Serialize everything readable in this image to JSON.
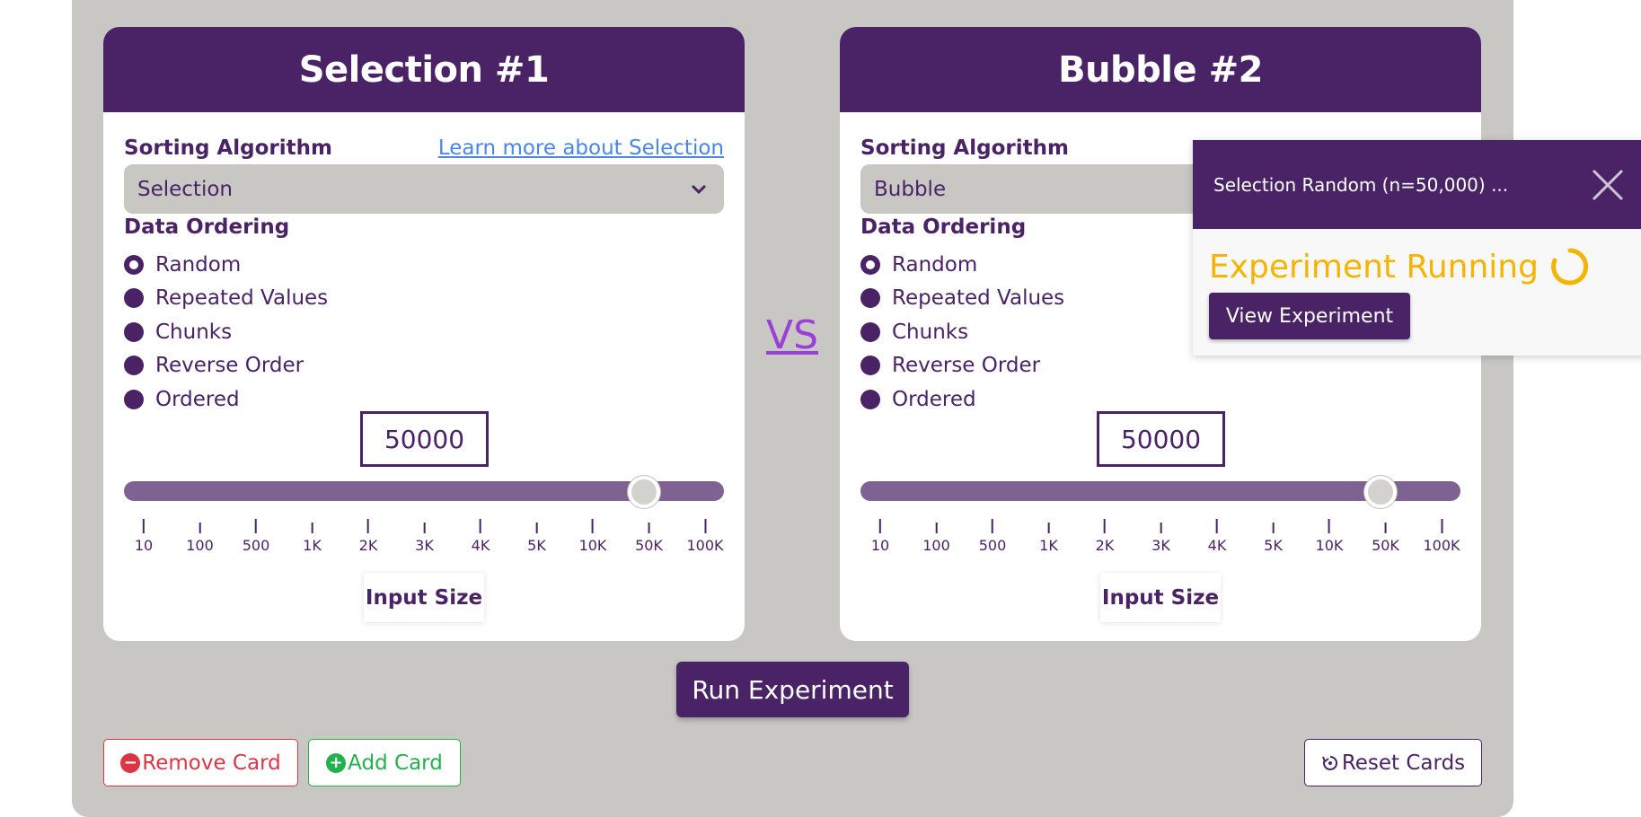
{
  "colors": {
    "primary": "#4a2366",
    "panel_bg": "#c9c7c3",
    "link": "#4a86e8",
    "vs": "#9b40d6",
    "remove": "#dc3545",
    "add": "#22b14c",
    "running": "#f5b400"
  },
  "cards": [
    {
      "title": "Selection #1",
      "algorithm_label": "Sorting Algorithm",
      "learn_more": "Learn more about Selection",
      "selected_algorithm": "Selection",
      "ordering_label": "Data Ordering",
      "orderings": [
        "Random",
        "Repeated Values",
        "Chunks",
        "Reverse Order",
        "Ordered"
      ],
      "selected_ordering": "Random",
      "input_size": "50000",
      "slider_ticks": [
        "10",
        "100",
        "500",
        "1K",
        "2K",
        "3K",
        "4K",
        "5K",
        "10K",
        "50K",
        "100K"
      ],
      "slider_value": "50K",
      "input_size_label": "Input Size"
    },
    {
      "title": "Bubble #2",
      "algorithm_label": "Sorting Algorithm",
      "selected_algorithm": "Bubble",
      "ordering_label": "Data Ordering",
      "orderings": [
        "Random",
        "Repeated Values",
        "Chunks",
        "Reverse Order",
        "Ordered"
      ],
      "selected_ordering": "Random",
      "input_size": "50000",
      "slider_ticks": [
        "10",
        "100",
        "500",
        "1K",
        "2K",
        "3K",
        "4K",
        "5K",
        "10K",
        "50K",
        "100K"
      ],
      "slider_value": "50K",
      "input_size_label": "Input Size"
    }
  ],
  "vs_label": "VS",
  "run_button": "Run Experiment",
  "remove_card": "Remove Card",
  "add_card": "Add Card",
  "reset_cards": "Reset Cards",
  "toast": {
    "title": "Selection Random (n=50,000) ...",
    "status": "Experiment Running",
    "view_button": "View Experiment"
  },
  "icons": {
    "select_arrow": "chevron-down-icon",
    "remove": "minus-circle-icon",
    "add": "plus-circle-icon",
    "reset": "reset-icon",
    "close": "close-icon",
    "spinner": "spinner-icon"
  }
}
